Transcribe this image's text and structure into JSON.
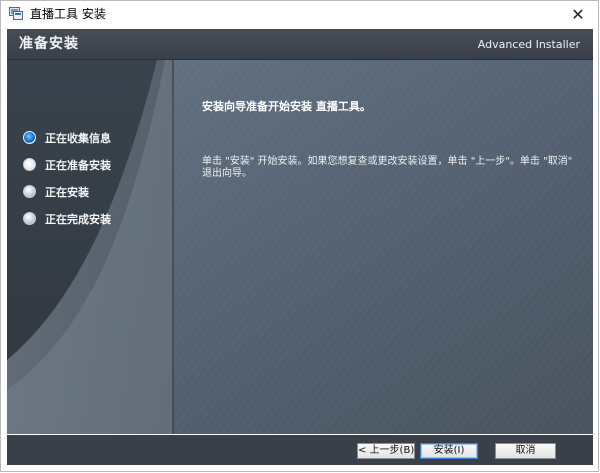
{
  "window": {
    "title": "直播工具 安装",
    "close_glyph": "✕"
  },
  "header": {
    "title": "准备安装",
    "brand": "Advanced Installer"
  },
  "steps": [
    {
      "label": "正在收集信息",
      "state": "done"
    },
    {
      "label": "正在准备安装",
      "state": "current"
    },
    {
      "label": "正在安装",
      "state": "pending"
    },
    {
      "label": "正在完成安装",
      "state": "pending"
    }
  ],
  "main": {
    "heading": "安装向导准备开始安装 直播工具。",
    "description": "单击 \"安装\" 开始安装。如果您想复查或更改安装设置，单击 \"上一步\"。单击 \"取消\" 退出向导。"
  },
  "buttons": {
    "back": "< 上一步(B)",
    "install": "安装(I)",
    "cancel": "取消"
  },
  "colors": {
    "header_bg": "#3f4650",
    "content_bg": "#596676",
    "step_active": "#1d7fe0"
  }
}
